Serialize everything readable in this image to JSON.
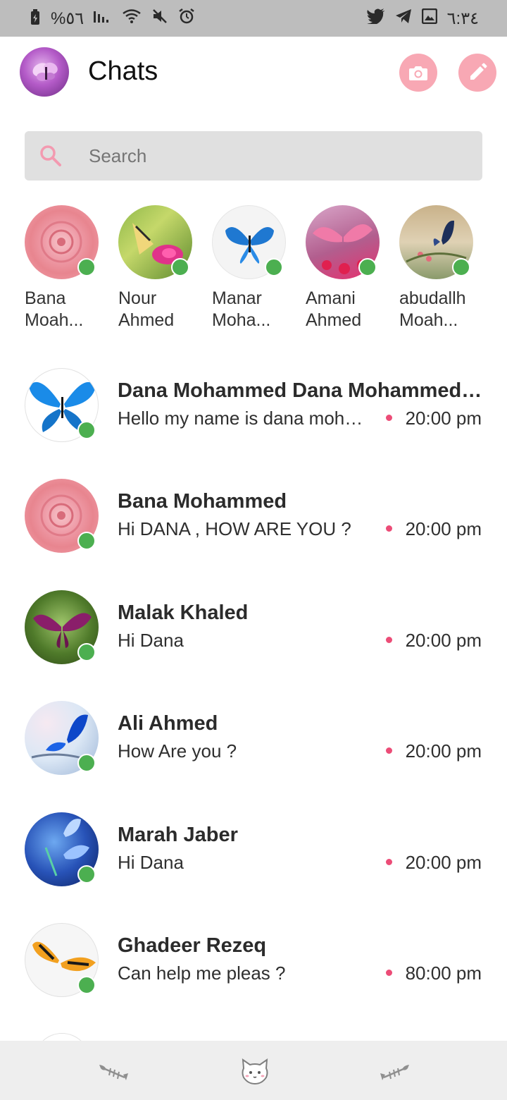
{
  "status_bar": {
    "battery_text": "%٥٦",
    "time": "٦:٣٤"
  },
  "header": {
    "title": "Chats",
    "camera_icon": "camera-icon",
    "edit_icon": "pencil-icon"
  },
  "search": {
    "placeholder": "Search"
  },
  "stories": [
    {
      "line1": "Bana",
      "line2": "Moah...",
      "online": true
    },
    {
      "line1": "Nour",
      "line2": "Ahmed",
      "online": true
    },
    {
      "line1": "Manar",
      "line2": "Moha...",
      "online": true
    },
    {
      "line1": "Amani",
      "line2": "Ahmed",
      "online": true
    },
    {
      "line1": "abudallh",
      "line2": "Moah...",
      "online": true
    }
  ],
  "chats": [
    {
      "name": "Dana Mohammed Dana Mohammed Dana",
      "message": "Hello my name is dana mohammed",
      "time": "20:00 pm",
      "online": true
    },
    {
      "name": "Bana Mohammed",
      "message": "Hi DANA , HOW ARE YOU ?",
      "time": "20:00 pm",
      "online": true
    },
    {
      "name": "Malak Khaled",
      "message": "Hi Dana",
      "time": "20:00 pm",
      "online": true
    },
    {
      "name": "Ali Ahmed",
      "message": "How Are you ?",
      "time": "20:00 pm",
      "online": true
    },
    {
      "name": "Marah Jaber",
      "message": "Hi Dana",
      "time": "20:00 pm",
      "online": true
    },
    {
      "name": "Ghadeer Rezeq",
      "message": "Can help me pleas ?",
      "time": "80:00 pm",
      "online": true
    }
  ],
  "bottom_nav": {
    "left_icon": "fish-bone-icon",
    "center_icon": "cat-face-icon",
    "right_icon": "fish-bone-icon"
  },
  "colors": {
    "accent_pink": "#f8a8b4",
    "online_green": "#4caf50",
    "unread_dot": "#ec4c77",
    "status_bar_bg": "#bdbdbd",
    "search_bg": "#e0e0e0",
    "nav_bg": "#eeeeee"
  }
}
